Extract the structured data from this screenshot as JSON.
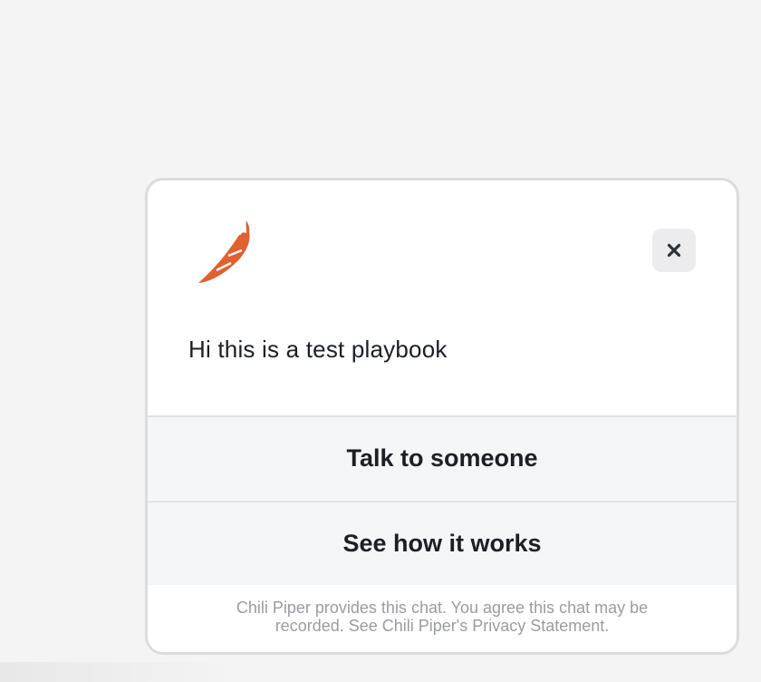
{
  "widget": {
    "logo_icon": "chili-pepper-icon",
    "close_icon": "close-icon",
    "message": "Hi this is a test playbook",
    "buttons": [
      {
        "label": "Talk to someone"
      },
      {
        "label": "See how it works"
      }
    ],
    "footer": {
      "line1": "Chili Piper provides this chat. You agree this chat may be",
      "line2": "recorded. See Chili Piper's Privacy Statement."
    }
  },
  "colors": {
    "brand_orange": "#e0602f",
    "page_background": "#f4f4f5",
    "button_background": "#f4f5f7",
    "text_dark": "#1b1f26",
    "footer_text": "#9a9ca1"
  }
}
